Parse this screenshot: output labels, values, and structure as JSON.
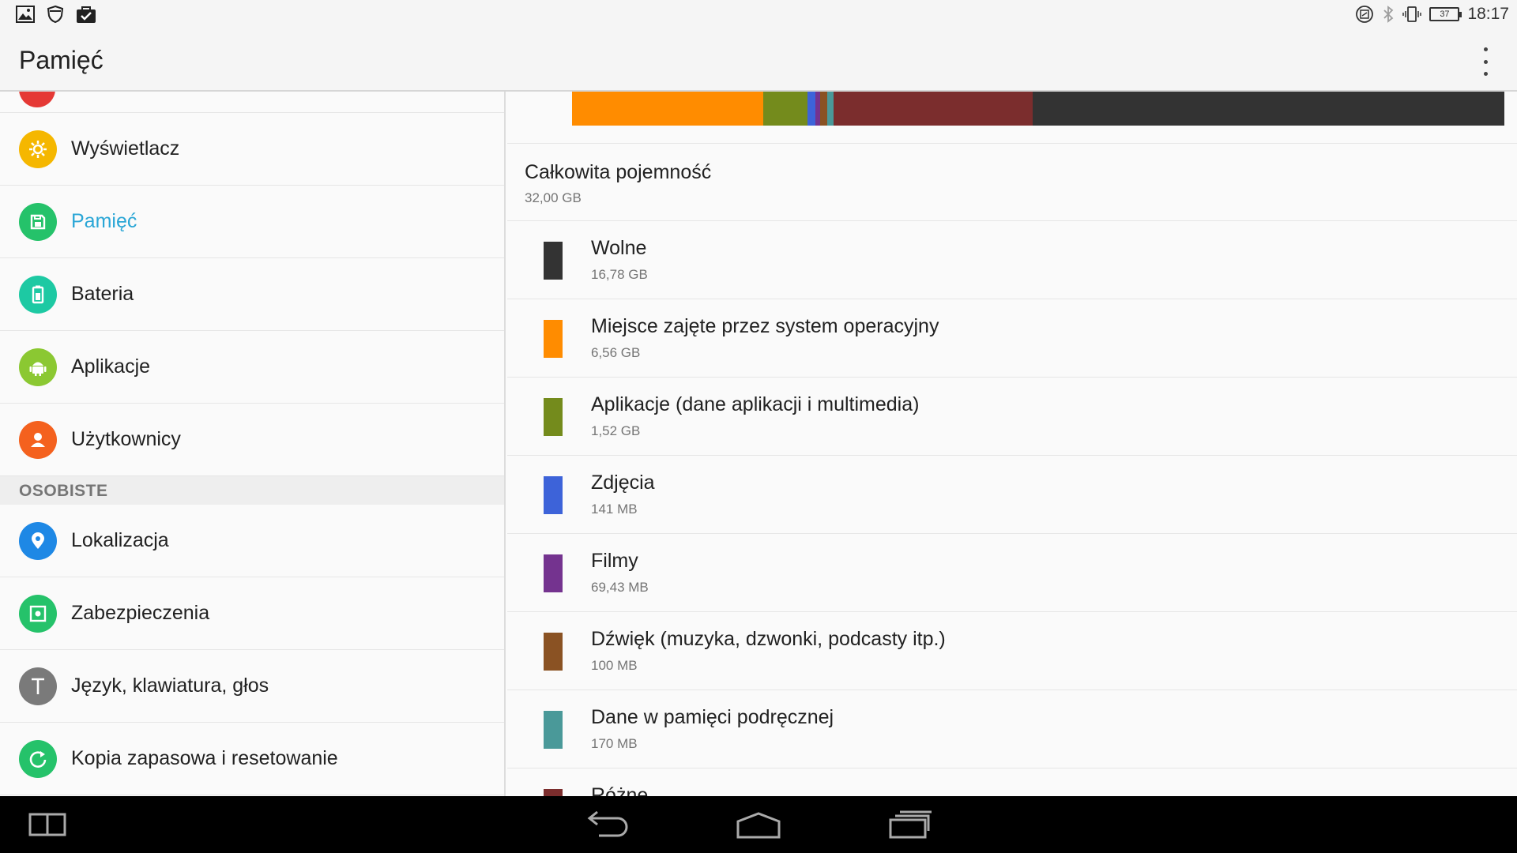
{
  "status_bar": {
    "time": "18:17",
    "battery_level": "37",
    "left_icons": [
      "gallery-icon",
      "shield-icon",
      "shopping-bag-icon"
    ],
    "right_icons": [
      "nfc-icon",
      "bluetooth-icon",
      "vibrate-icon",
      "battery-icon"
    ]
  },
  "action_bar": {
    "title": "Pamięć"
  },
  "sidebar": {
    "items": [
      {
        "label": "Wyświetlacz",
        "icon": "brightness-icon",
        "color": "#f5b700"
      },
      {
        "label": "Pamięć",
        "icon": "storage-icon",
        "color": "#25c26a",
        "active": true
      },
      {
        "label": "Bateria",
        "icon": "battery-icon",
        "color": "#1dc9a3"
      },
      {
        "label": "Aplikacje",
        "icon": "android-icon",
        "color": "#8bc832"
      },
      {
        "label": "Użytkownicy",
        "icon": "person-icon",
        "color": "#f4611e"
      }
    ],
    "section_label": "OSOBISTE",
    "personal_items": [
      {
        "label": "Lokalizacja",
        "icon": "location-icon",
        "color": "#1e88e5"
      },
      {
        "label": "Zabezpieczenia",
        "icon": "lock-icon",
        "color": "#25c26a"
      },
      {
        "label": "Język, klawiatura, głos",
        "icon": "text-icon",
        "color": "#7a7a7a"
      },
      {
        "label": "Kopia zapasowa i resetowanie",
        "icon": "restore-icon",
        "color": "#25c26a"
      }
    ]
  },
  "storage": {
    "total_label": "Całkowita pojemność",
    "total_value": "32,00 GB",
    "categories": [
      {
        "label": "Wolne",
        "value": "16,78 GB",
        "color": "#333333"
      },
      {
        "label": "Miejsce zajęte przez system operacyjny",
        "value": "6,56 GB",
        "color": "#ff8c00"
      },
      {
        "label": "Aplikacje (dane aplikacji i multimedia)",
        "value": "1,52 GB",
        "color": "#748b1c"
      },
      {
        "label": "Zdjęcia",
        "value": "141 MB",
        "color": "#3d63d9"
      },
      {
        "label": "Filmy",
        "value": "69,43 MB",
        "color": "#74338f"
      },
      {
        "label": "Dźwięk (muzyka, dzwonki, podcasty itp.)",
        "value": "100 MB",
        "color": "#8a5223"
      },
      {
        "label": "Dane w pamięci podręcznej",
        "value": "170 MB",
        "color": "#4a9999"
      },
      {
        "label": "Różne",
        "value": "",
        "color": "#7b2d2d"
      }
    ],
    "bar_segments": [
      {
        "name": "system",
        "fraction": 0.205,
        "color": "#ff8c00"
      },
      {
        "name": "apps",
        "fraction": 0.0475,
        "color": "#748b1c"
      },
      {
        "name": "photos",
        "fraction": 0.0085,
        "color": "#3d63d9"
      },
      {
        "name": "videos",
        "fraction": 0.0055,
        "color": "#74338f"
      },
      {
        "name": "audio",
        "fraction": 0.007,
        "color": "#8a5223"
      },
      {
        "name": "cache",
        "fraction": 0.007,
        "color": "#4a9999"
      },
      {
        "name": "misc",
        "fraction": 0.214,
        "color": "#7b2d2d"
      },
      {
        "name": "free",
        "fraction": 0.5055,
        "color": "#333333"
      }
    ]
  },
  "nav_bar": {
    "buttons": [
      "multi-window-icon",
      "back-icon",
      "home-icon",
      "recents-icon"
    ]
  }
}
